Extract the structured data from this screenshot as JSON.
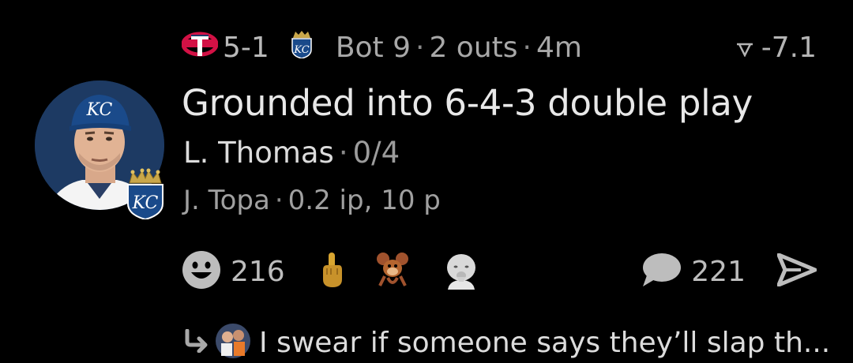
{
  "game": {
    "score": "5-1",
    "inning": "Bot 9",
    "outs": "2 outs",
    "time_ago": "4m",
    "win_prob_delta": "-7.1",
    "separator": "·"
  },
  "play": {
    "description": "Grounded into 6-4-3 double play",
    "batter_name": "L. Thomas",
    "batter_stat": "0/4",
    "pitcher_name": "J. Topa",
    "pitcher_stat": "0.2 ip, 10 p"
  },
  "reactions": {
    "smile_count": "216",
    "icons": [
      "smile-icon",
      "middle-finger-emoji",
      "cartoon-mouse-sticker",
      "baby-face-sticker"
    ]
  },
  "comments": {
    "count": "221"
  },
  "reply_preview": {
    "text": "I swear if someone says they’ll slap th..."
  },
  "colors": {
    "background": "#000000",
    "twins_red": "#d31145",
    "royals_blue": "#1a4a8a",
    "reaction_gray": "#bdbdbd"
  }
}
